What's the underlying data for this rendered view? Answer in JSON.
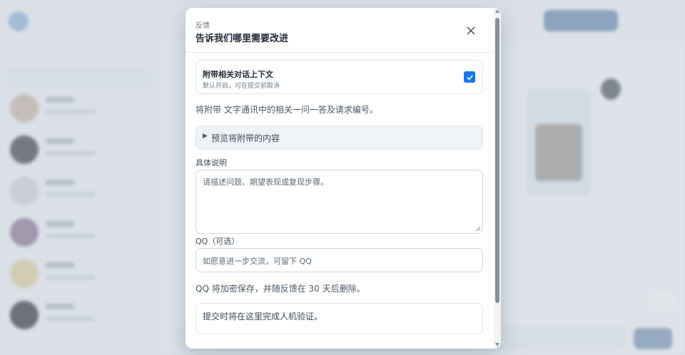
{
  "modal": {
    "kicker": "反馈",
    "title": "告诉我们哪里需要改进",
    "close_icon": "close-icon"
  },
  "attach_context": {
    "label": "附带相关对话上下文",
    "sublabel": "默认开启，可在提交前取消",
    "checked": true
  },
  "description": "将附带 文字通讯中的相关一问一答及请求编号。",
  "preview": {
    "arrow": "▶",
    "label": "预览将附带的内容"
  },
  "details": {
    "label": "具体说明",
    "placeholder": "请描述问题、期望表现或复现步骤。"
  },
  "qq": {
    "label": "QQ（可选）",
    "placeholder": "如愿意进一步交流，可留下 QQ"
  },
  "privacy_note": "QQ 将加密保存，并随反馈在 30 天后删除。",
  "captcha_text": "提交时将在这里完成人机验证。",
  "colors": {
    "accent": "#1a73e8"
  }
}
